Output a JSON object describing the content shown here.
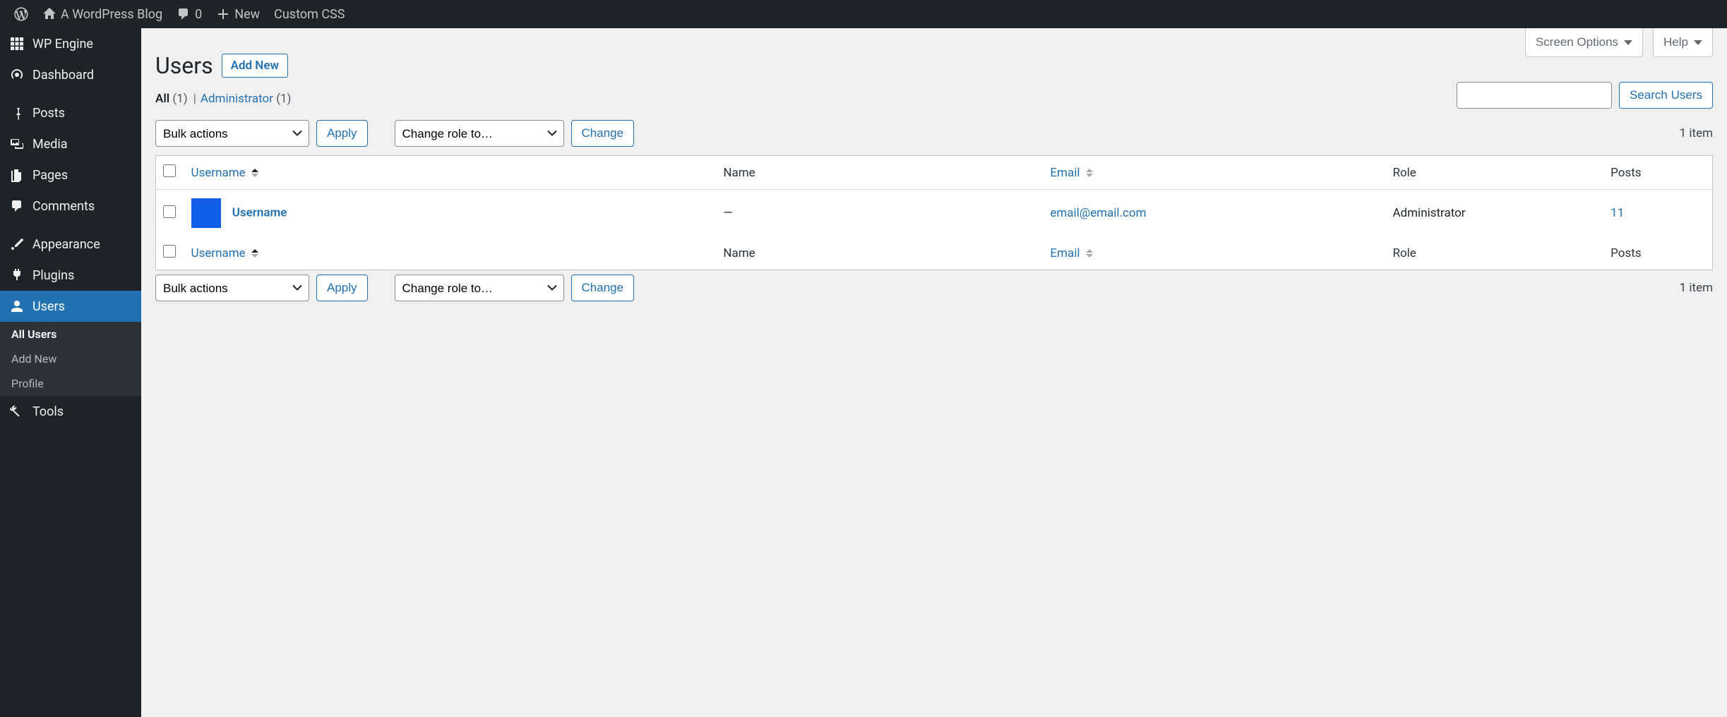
{
  "colors": {
    "accent": "#2271b1",
    "admin_dark": "#1d2327"
  },
  "admin_bar": {
    "site_name": "A WordPress Blog",
    "comments_count": "0",
    "new_label": "New",
    "custom_css_label": "Custom CSS"
  },
  "sidebar": {
    "items": [
      {
        "label": "WP Engine"
      },
      {
        "label": "Dashboard"
      },
      {
        "label": "Posts"
      },
      {
        "label": "Media"
      },
      {
        "label": "Pages"
      },
      {
        "label": "Comments"
      },
      {
        "label": "Appearance"
      },
      {
        "label": "Plugins"
      },
      {
        "label": "Users"
      },
      {
        "label": "Tools"
      }
    ],
    "submenu": [
      {
        "label": "All Users"
      },
      {
        "label": "Add New"
      },
      {
        "label": "Profile"
      }
    ]
  },
  "top_tabs": {
    "screen_options": "Screen Options",
    "help": "Help"
  },
  "page": {
    "title": "Users",
    "add_new": "Add New"
  },
  "filters": {
    "all_label": "All",
    "all_count": "(1)",
    "admin_label": "Administrator",
    "admin_count": "(1)"
  },
  "search": {
    "button": "Search Users",
    "value": ""
  },
  "bulk": {
    "actions_label": "Bulk actions",
    "apply": "Apply",
    "role_label": "Change role to…",
    "change": "Change"
  },
  "page_info": {
    "count_text": "1 item"
  },
  "table": {
    "columns": {
      "username": "Username",
      "name": "Name",
      "email": "Email",
      "role": "Role",
      "posts": "Posts"
    },
    "rows": [
      {
        "username": "Username",
        "name": "—",
        "email": "email@email.com",
        "role": "Administrator",
        "posts": "11"
      }
    ]
  }
}
